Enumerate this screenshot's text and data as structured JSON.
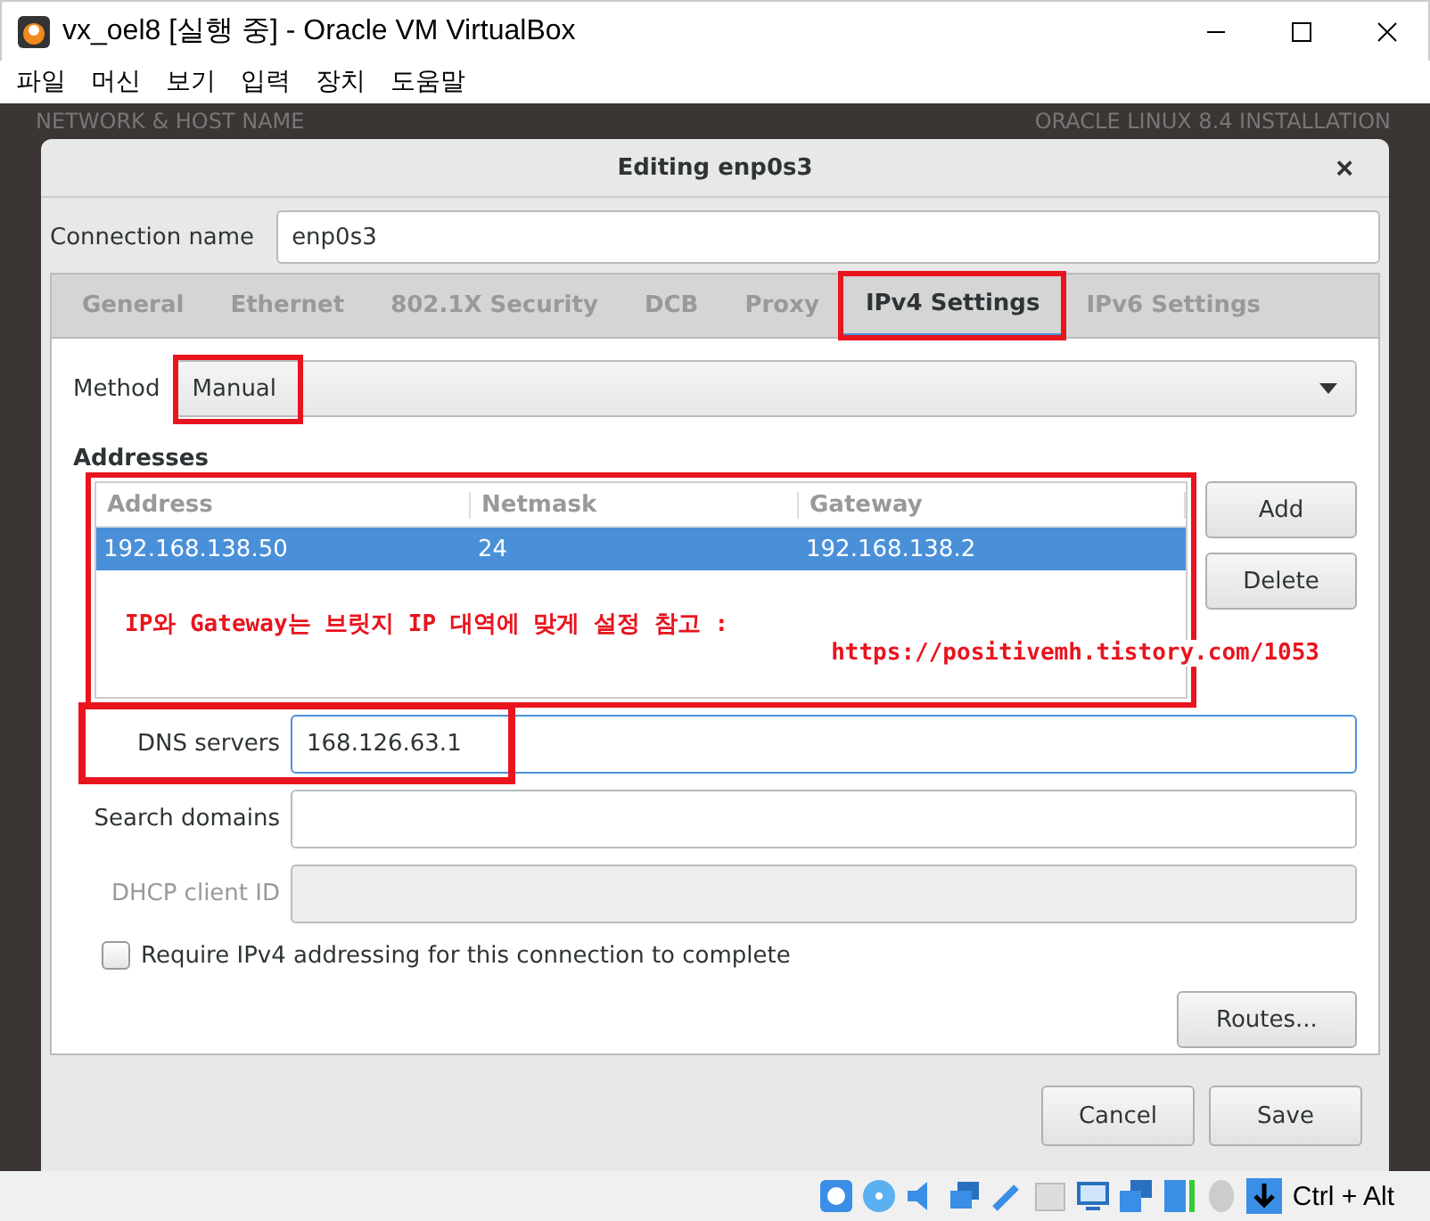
{
  "window": {
    "title": "vx_oel8 [실행 중] - Oracle VM VirtualBox"
  },
  "menu": [
    "파일",
    "머신",
    "보기",
    "입력",
    "장치",
    "도움말"
  ],
  "background": {
    "left_heading": "NETWORK & HOST NAME",
    "right_heading": "ORACLE LINUX 8.4 INSTALLATION"
  },
  "dialog": {
    "title": "Editing enp0s3",
    "close": "×",
    "connection_name": {
      "label": "Connection name",
      "value": "enp0s3"
    },
    "tabs": [
      {
        "label": "General",
        "selected": false,
        "highlighted": false
      },
      {
        "label": "Ethernet",
        "selected": false,
        "highlighted": false
      },
      {
        "label": "802.1X Security",
        "selected": false,
        "highlighted": false
      },
      {
        "label": "DCB",
        "selected": false,
        "highlighted": false
      },
      {
        "label": "Proxy",
        "selected": false,
        "highlighted": false
      },
      {
        "label": "IPv4 Settings",
        "selected": true,
        "highlighted": true
      },
      {
        "label": "IPv6 Settings",
        "selected": false,
        "highlighted": false
      }
    ],
    "method": {
      "label": "Method",
      "value": "Manual",
      "highlighted": true
    },
    "addresses": {
      "heading": "Addresses",
      "highlighted": true,
      "columns": [
        "Address",
        "Netmask",
        "Gateway"
      ],
      "rows": [
        {
          "cells": [
            "192.168.138.50",
            "24",
            "192.168.138.2"
          ],
          "selected": true
        }
      ],
      "buttons": [
        "Add",
        "Delete"
      ]
    },
    "annotation": [
      "IP와 Gateway는 브릿지 IP 대역에 맞게 설정 참고 :",
      "https://positivemh.tistory.com/1053"
    ],
    "fields": [
      {
        "label": "DNS servers",
        "value": "168.126.63.1",
        "disabled": false,
        "focused": true,
        "highlighted": true
      },
      {
        "label": "Search domains",
        "disabled": false,
        "focused": false,
        "highlighted": false
      },
      {
        "label": "DHCP client ID",
        "disabled": true,
        "focused": false,
        "highlighted": false
      }
    ],
    "require": {
      "label": "Require IPv4 addressing for this connection to complete",
      "checked": false
    },
    "routes_button": "Routes...",
    "buttons": [
      "Cancel",
      "Save"
    ]
  },
  "status_bar": {
    "host_key": "Ctrl + Alt"
  }
}
